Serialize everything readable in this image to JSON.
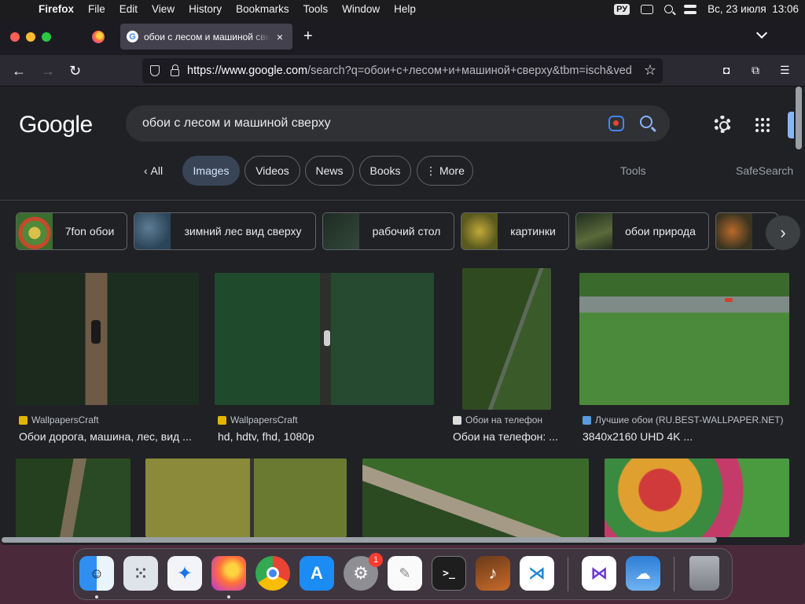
{
  "menubar": {
    "apple": "",
    "items": [
      "Firefox",
      "File",
      "Edit",
      "View",
      "History",
      "Bookmarks",
      "Tools",
      "Window",
      "Help"
    ],
    "input_source": "РУ",
    "datetime": "Вс, 23 июля  13:06"
  },
  "browser": {
    "tab_title": "обои с лесом и машиной сверху",
    "tab_close": "×",
    "new_tab": "+",
    "url_host": "https://www.google.com",
    "url_rest": "/search?q=обои+с+лесом+и+машиной+сверху&tbm=isch&ved"
  },
  "google": {
    "logo": "Google",
    "query": "обои с лесом и машиной сверху",
    "filters": [
      {
        "label": "All",
        "prefix": "‹ "
      },
      {
        "label": "Images"
      },
      {
        "label": "Videos"
      },
      {
        "label": "News"
      },
      {
        "label": "Books"
      },
      {
        "label": "More",
        "prefix": "⋮ "
      }
    ],
    "tools": "Tools",
    "safesearch": "SafeSearch",
    "related": [
      "7fon обои",
      "зимний лес вид сверху",
      "рабочий стол",
      "картинки",
      "обои природа"
    ],
    "results_row1": [
      {
        "source": "WallpapersCraft",
        "caption": "Обои дорога, машина, лес, вид ..."
      },
      {
        "source": "WallpapersCraft",
        "caption": "hd, hdtv, fhd, 1080p"
      },
      {
        "source": "Обои на телефон",
        "caption": "Обои на телефон: ..."
      },
      {
        "source": "Лучшие обои (RU.BEST-WALLPAPER.NET)",
        "caption": "3840x2160 UHD 4K ..."
      }
    ]
  },
  "dock": {
    "settings_badge": "1",
    "apps": [
      "finder",
      "launchpad",
      "safari",
      "firefox",
      "chrome",
      "app-store",
      "system-settings",
      "textedit",
      "terminal",
      "garageband",
      "vscode",
      "visual-studio",
      "weather",
      "trash"
    ]
  }
}
